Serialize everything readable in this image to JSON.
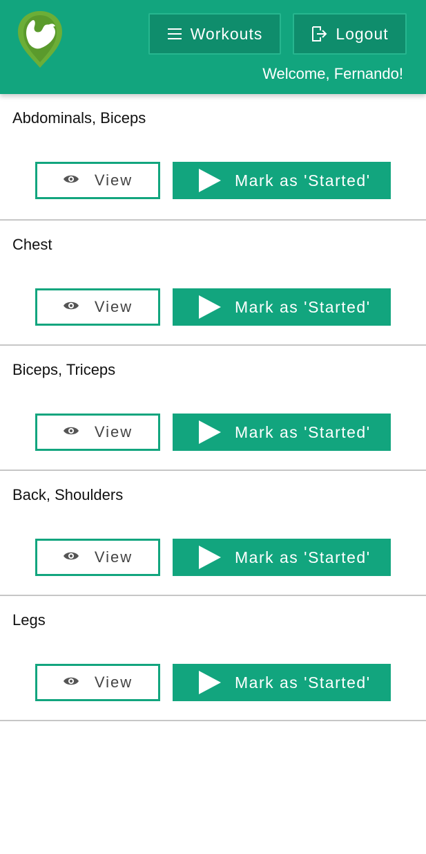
{
  "header": {
    "nav_workouts_label": "Workouts",
    "nav_logout_label": "Logout",
    "welcome_text": "Welcome, Fernando!"
  },
  "colors": {
    "brand": "#12a57e",
    "brand_dark": "#0f8d6c",
    "logo_green": "#6cae37"
  },
  "icons": {
    "logo": "flexed-arm-pin-logo",
    "menu": "hamburger-icon",
    "logout": "logout-icon",
    "view": "eye-icon",
    "start": "play-icon"
  },
  "workouts": [
    {
      "title": "Abdominals, Biceps",
      "view_label": "View",
      "start_label": "Mark as 'Started'"
    },
    {
      "title": "Chest",
      "view_label": "View",
      "start_label": "Mark as 'Started'"
    },
    {
      "title": "Biceps, Triceps",
      "view_label": "View",
      "start_label": "Mark as 'Started'"
    },
    {
      "title": "Back, Shoulders",
      "view_label": "View",
      "start_label": "Mark as 'Started'"
    },
    {
      "title": "Legs",
      "view_label": "View",
      "start_label": "Mark as 'Started'"
    }
  ]
}
